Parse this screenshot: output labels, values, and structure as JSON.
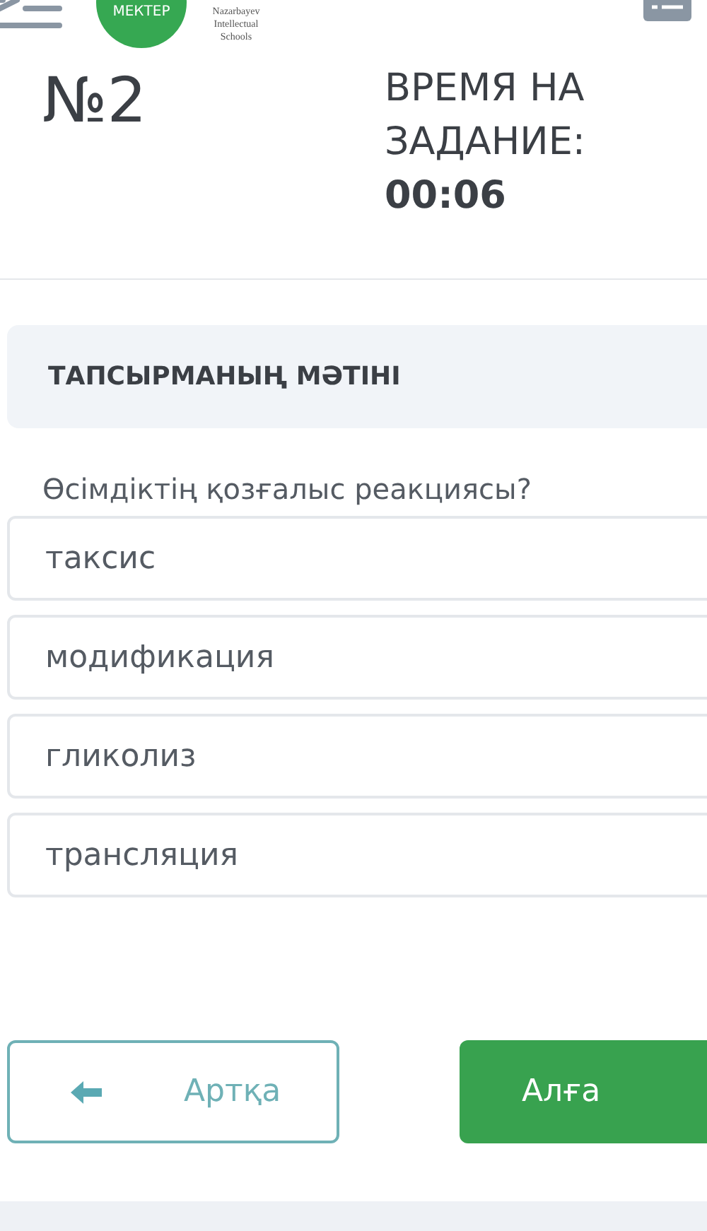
{
  "header": {
    "logo_text": "МЕКТЕР",
    "org_name": "Nazarbayev Intellectual Schools"
  },
  "task": {
    "number": "№2",
    "time_label": "ВРЕМЯ НА ЗАДАНИЕ:",
    "time_value": "00:06"
  },
  "section_title": "ТАПСЫРМАНЫҢ МӘТІНІ",
  "question": "Өсімдіктің қозғалыс реакциясы?",
  "options": [
    {
      "label": "таксис",
      "selected": false
    },
    {
      "label": "модификация",
      "selected": false
    },
    {
      "label": "гликолиз",
      "selected": false
    },
    {
      "label": "трансляция",
      "selected": false
    }
  ],
  "buttons": {
    "back": "Артқа",
    "next": "Алға"
  }
}
